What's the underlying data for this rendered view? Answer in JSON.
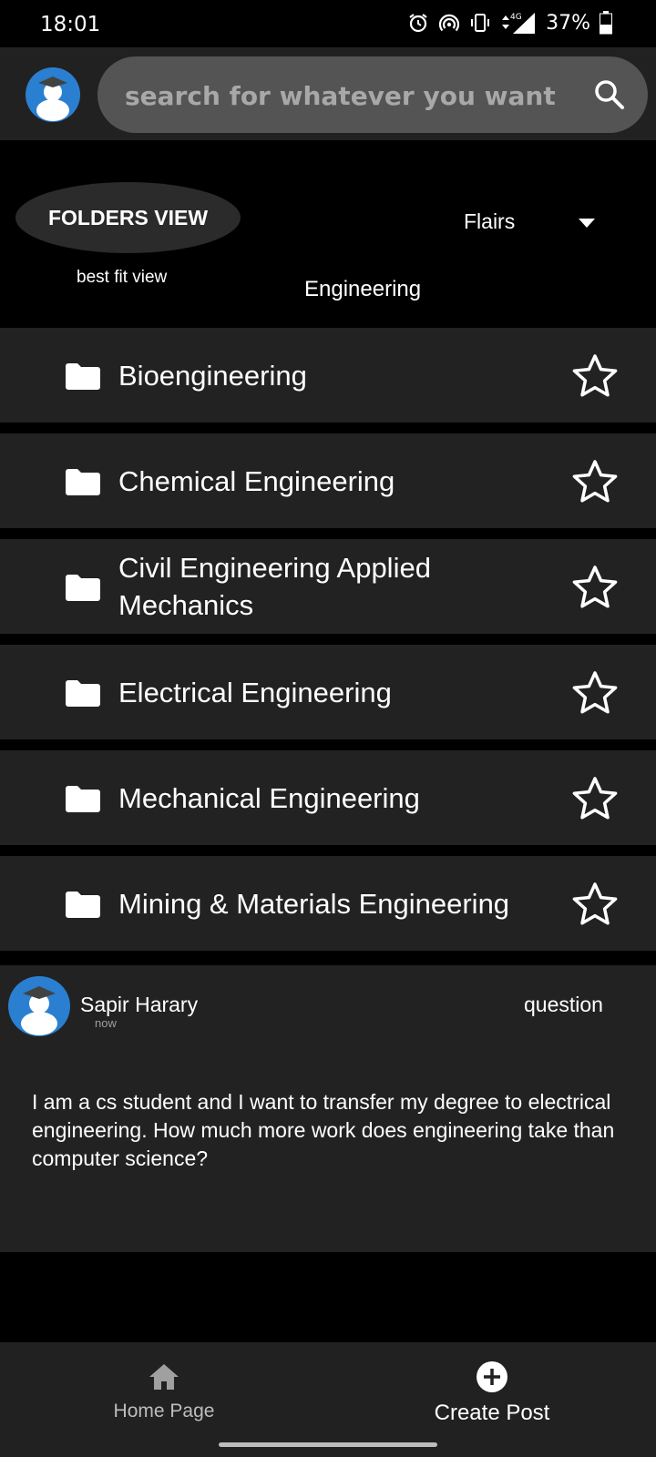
{
  "status_bar": {
    "time": "18:01",
    "battery": "37%",
    "network": "4G",
    "icons": [
      "alarm-icon",
      "hotspot-icon",
      "vibrate-icon",
      "signal-icon",
      "battery-icon"
    ]
  },
  "header": {
    "avatar_icon": "user-avatar-icon",
    "search": {
      "placeholder": "search for whatever you want",
      "icon": "search-icon"
    }
  },
  "controls": {
    "folders_view": "FOLDERS VIEW",
    "best_fit_view": "best fit view",
    "flairs_dropdown": {
      "label": "Flairs"
    },
    "category": "Engineering"
  },
  "folders": [
    {
      "name": "Bioengineering"
    },
    {
      "name": "Chemical Engineering"
    },
    {
      "name": "Civil Engineering Applied Mechanics"
    },
    {
      "name": "Electrical Engineering"
    },
    {
      "name": "Mechanical Engineering"
    },
    {
      "name": "Mining & Materials Engineering"
    }
  ],
  "post": {
    "author": "Sapir Harary",
    "time": "now",
    "flair": "question",
    "body": "I am a cs student and I want to transfer my degree to electrical engineering. How much more work does engineering take than computer science?"
  },
  "bottom_nav": {
    "home_label": "Home Page",
    "create_label": "Create Post"
  },
  "colors": {
    "background": "#000000",
    "surface": "#222222",
    "search_field": "#545454",
    "avatar_blue": "#2a7fd0"
  }
}
